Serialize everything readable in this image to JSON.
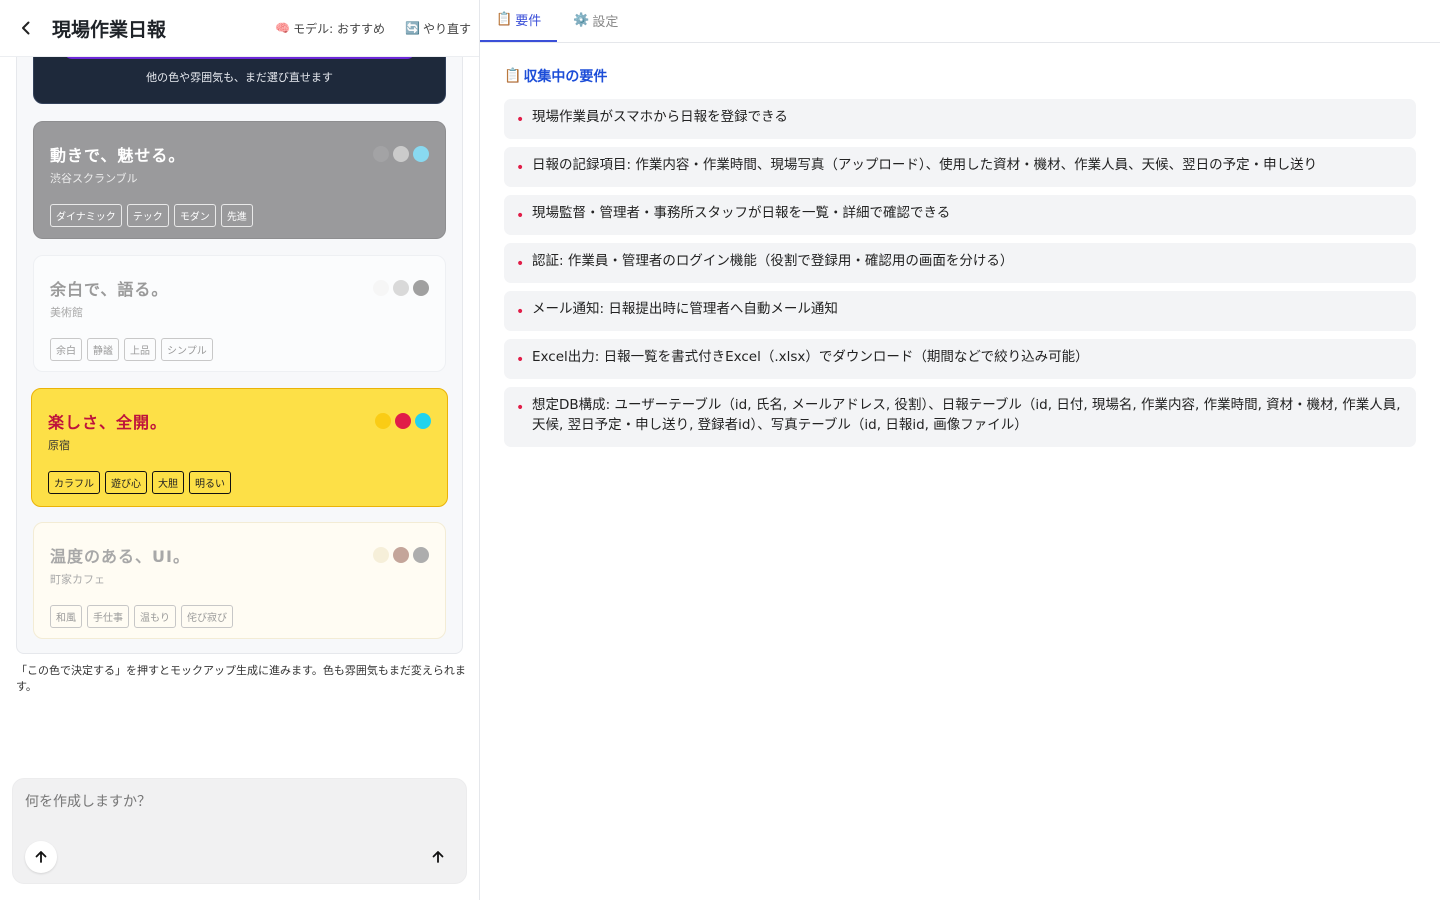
{
  "header": {
    "title": "現場作業日報",
    "model_label": "モデル: おすすめ",
    "retry_label": "やり直す",
    "back_icon": "chevron-left-icon",
    "model_icon": "brain-icon",
    "retry_icon": "refresh-icon"
  },
  "theme_cards": {
    "dark_card_note": "他の色や雰囲気も、まだ選び直せます",
    "cards": [
      {
        "title": "動きで、魅せる。",
        "subtitle": "渋谷スクランブル",
        "tags": [
          "ダイナミック",
          "テック",
          "モダン",
          "先進"
        ],
        "colors": [
          "#9e9ea0",
          "#c9c9c9",
          "#89d9f0"
        ]
      },
      {
        "title": "余白で、語る。",
        "subtitle": "美術館",
        "tags": [
          "余白",
          "静謐",
          "上品",
          "シンプル"
        ],
        "colors": [
          "#f6f6f6",
          "#d9d9d9",
          "#a0a0a0"
        ]
      },
      {
        "title": "楽しさ、全開。",
        "subtitle": "原宿",
        "tags": [
          "カラフル",
          "遊び心",
          "大胆",
          "明るい"
        ],
        "colors": [
          "#facc15",
          "#e11d48",
          "#22d3ee"
        ]
      },
      {
        "title": "温度のある、UI。",
        "subtitle": "町家カフェ",
        "tags": [
          "和風",
          "手仕事",
          "温もり",
          "侘び寂び"
        ],
        "colors": [
          "#f6efd9",
          "#c4a59a",
          "#adadad"
        ]
      }
    ]
  },
  "help_text": "「この色で決定する」を押すとモックアップ生成に進みます。色も雰囲気もまだ変えられます。",
  "composer": {
    "placeholder": "何を作成しますか？"
  },
  "tabs": [
    {
      "label": "要件",
      "icon": "clipboard-icon",
      "active": true
    },
    {
      "label": "設定",
      "icon": "gear-icon",
      "active": false
    }
  ],
  "requirements": {
    "title": "収集中の要件",
    "items": [
      "現場作業員がスマホから日報を登録できる",
      "日報の記録項目: 作業内容・作業時間、現場写真（アップロード）、使用した資材・機材、作業人員、天候、翌日の予定・申し送り",
      "現場監督・管理者・事務所スタッフが日報を一覧・詳細で確認できる",
      "認証: 作業員・管理者のログイン機能（役割で登録用・確認用の画面を分ける）",
      "メール通知: 日報提出時に管理者へ自動メール通知",
      "Excel出力: 日報一覧を書式付きExcel（.xlsx）でダウンロード（期間などで絞り込み可能）",
      "想定DB構成: ユーザーテーブル（id, 氏名, メールアドレス, 役割）、日報テーブル（id, 日付, 現場名, 作業内容, 作業時間, 資材・機材, 作業人員, 天候, 翌日予定・申し送り, 登録者id）、写真テーブル（id, 日報id, 画像ファイル）"
    ]
  }
}
